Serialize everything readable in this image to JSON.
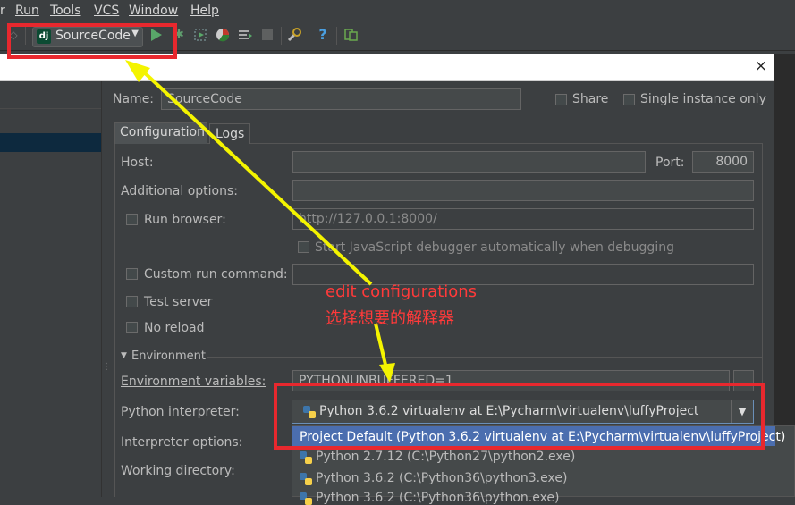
{
  "menu": [
    "r",
    "Run",
    "Tools",
    "VCS",
    "Window",
    "Help"
  ],
  "toolbar": {
    "run_config_badge": "dj",
    "run_config_label": "SourceCode",
    "icons": [
      "run-icon",
      "debug-icon",
      "coverage-icon",
      "profile-icon",
      "concurrency-icon",
      "stop-icon",
      "settings-icon",
      "help-icon",
      "sdk-manager-icon"
    ],
    "help_label": "?"
  },
  "dialog": {
    "close_label": "×",
    "name_label": "Name:",
    "name_value": "SourceCode",
    "share_label": "Share",
    "single_instance_label": "Single instance only",
    "tabs": [
      "Configuration",
      "Logs"
    ],
    "host_label": "Host:",
    "host_value": "",
    "port_label": "Port:",
    "port_value": "8000",
    "additional_options_label": "Additional options:",
    "run_browser_label": "Run browser:",
    "run_browser_url": "http://127.0.0.1:8000/",
    "js_debugger_label": "Start JavaScript debugger automatically when debugging",
    "custom_run_label": "Custom run command:",
    "test_server_label": "Test server",
    "no_reload_label": "No reload",
    "environment_label": "Environment",
    "env_vars_label": "Environment variables:",
    "env_vars_value": "PYTHONUNBUFFERED=1",
    "python_interpreter_label": "Python interpreter:",
    "interpreter_value": "Python 3.6.2 virtualenv at E:\\Pycharm\\virtualenv\\luffyProject",
    "interpreter_options_label": "Interpreter options:",
    "working_dir_label": "Working directory:",
    "interpreter_list": [
      "Project Default (Python 3.6.2 virtualenv at E:\\Pycharm\\virtualenv\\luffyProject)",
      "Python 2.7.12 (C:\\Python27\\python2.exe)",
      "Python 3.6.2 (C:\\Python36\\python3.exe)",
      "Python 3.6.2 (C:\\Python36\\python.exe)"
    ]
  },
  "annotation": {
    "line1": "edit configurations",
    "line2": "选择想要的解释器"
  },
  "colors": {
    "annotation_red": "#e8282e",
    "arrow_yellow": "#f4f400",
    "selection_blue": "#4b6eaf",
    "run_green": "#59a869"
  }
}
